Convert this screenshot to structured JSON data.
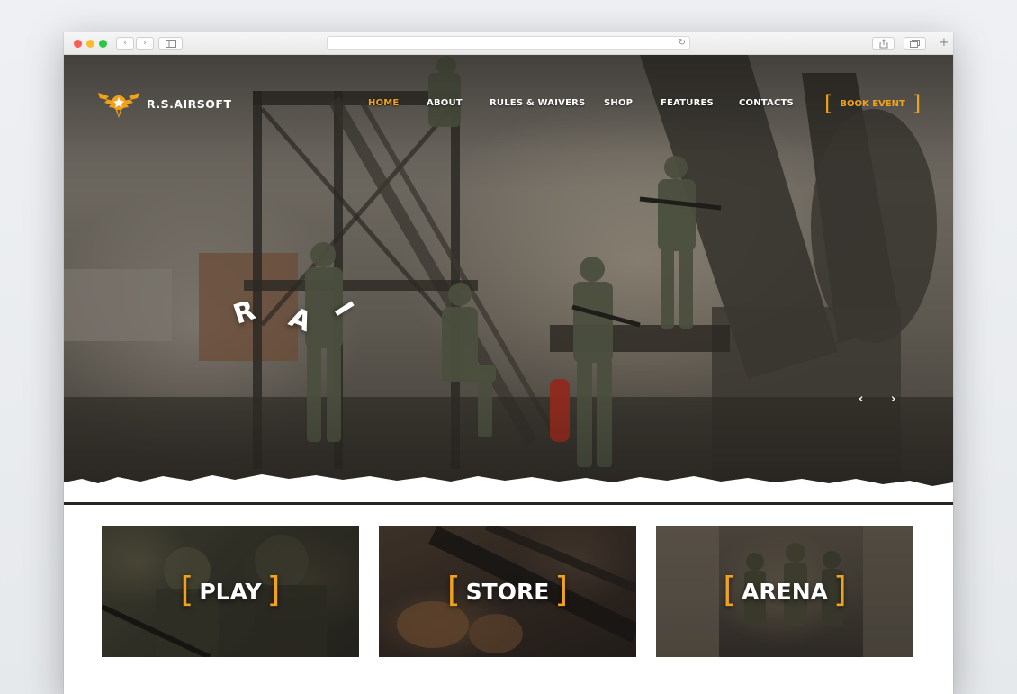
{
  "browser": {
    "controls": {
      "back": "‹",
      "forward": "›",
      "reload": "↻",
      "new_tab": "+"
    }
  },
  "brand": {
    "name": "R.S.AIRSOFT"
  },
  "nav": {
    "items": [
      {
        "label": "HOME",
        "active": true
      },
      {
        "label": "ABOUT",
        "active": false
      },
      {
        "label": "RULES & WAIVERS",
        "active": false
      },
      {
        "label": "SHOP",
        "active": false
      },
      {
        "label": "FEATURES",
        "active": false
      },
      {
        "label": "CONTACTS",
        "active": false
      }
    ],
    "cta": {
      "bracket_open": "[",
      "label": "BOOK EVENT",
      "bracket_close": "]"
    }
  },
  "hero": {
    "slide_letters": [
      "R",
      "A",
      "I"
    ],
    "prev_arrow": "‹",
    "next_arrow": "›"
  },
  "cards": [
    {
      "label": "PLAY"
    },
    {
      "label": "STORE"
    },
    {
      "label": "ARENA"
    }
  ],
  "colors": {
    "accent": "#f0a21d",
    "text_light": "#ffffff",
    "page_bg": "#ffffff"
  }
}
